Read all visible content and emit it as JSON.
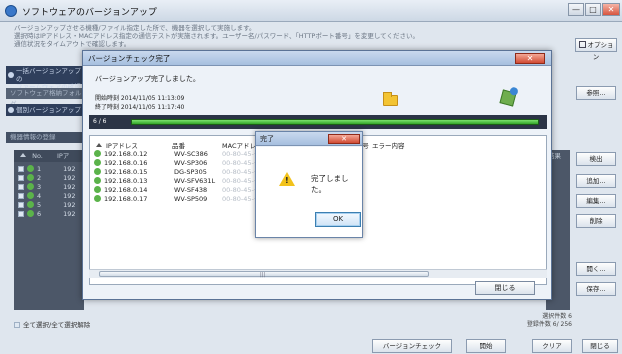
{
  "window": {
    "title": "ソフトウェアのバージョンアップ",
    "min": "—",
    "max": "□",
    "close": "✕"
  },
  "instructions": [
    "バージョンアップさせる機種/ファイル指定した所で、機器を選択して実施します。",
    "選択時はIPアドレス・MACアドレス指定の通信テストが実施されます。ユーザー名/パスワード、「HTTPポート番号」を変更してください。",
    "通信状況をタイムアウトで確認します。"
  ],
  "options_button": "オプション",
  "sections": {
    "s1": "一括バージョンアップの",
    "s1b": "ファームウェアの確認",
    "s2": "ソフトウェア格納フォルダ",
    "s3": "個別バージョンアップ",
    "s4": "機器情報の登録"
  },
  "side_buttons": {
    "browse": "参照...",
    "detect": "検出",
    "add": "追加...",
    "edit": "編集...",
    "delete": "削除",
    "open": "開く...",
    "save": "保存..."
  },
  "bg_list": {
    "col_no": "No.",
    "col_ip": "IPア",
    "rows": [
      {
        "no": "1",
        "ip": "192"
      },
      {
        "no": "2",
        "ip": "192"
      },
      {
        "no": "3",
        "ip": "192"
      },
      {
        "no": "4",
        "ip": "192"
      },
      {
        "no": "5",
        "ip": "192"
      },
      {
        "no": "6",
        "ip": "192"
      }
    ],
    "col_result": "結果"
  },
  "select_all": "全て選択/全て選択解除",
  "counts": {
    "selected": "選択件数  6",
    "registered": "登録件数  6/ 256"
  },
  "footer": {
    "version_check": "バージョンチェック",
    "start": "開始",
    "clear": "クリア",
    "close": "閉じる"
  },
  "dialog": {
    "title": "バージョンチェック完了",
    "close": "✕",
    "message": "バージョンアップ完了しました。",
    "start_time": "開始時刻 2014/11/05 11:13:09",
    "end_time": "終了時刻 2014/11/05 11:17:40",
    "progress_label": "6 / 6",
    "progress": 1.0,
    "close_button": "閉じる",
    "table": {
      "headers": {
        "ip": "IPアドレス",
        "model": "品番",
        "mac": "MACアドレス",
        "serial": "シリアル番号",
        "error": "エラー内容"
      },
      "rows": [
        {
          "ip": "192.168.0.12",
          "model": "WV-SC386",
          "mac": "00-80-45-··"
        },
        {
          "ip": "192.168.0.16",
          "model": "WV-SP306",
          "mac": "00-80-45-··"
        },
        {
          "ip": "192.168.0.15",
          "model": "DG-SP305",
          "mac": "00-80-45-··"
        },
        {
          "ip": "192.168.0.13",
          "model": "WV-SFV631L",
          "mac": "00-80-45-··"
        },
        {
          "ip": "192.168.0.14",
          "model": "WV-SF438",
          "mac": "00-80-45-··"
        },
        {
          "ip": "192.168.0.17",
          "model": "WV-SP509",
          "mac": "00-80-45-··"
        }
      ],
      "scroll_grip": "|||"
    }
  },
  "msgbox": {
    "title": "完了",
    "close": "✕",
    "text": "完了しました。",
    "ok": "OK"
  }
}
